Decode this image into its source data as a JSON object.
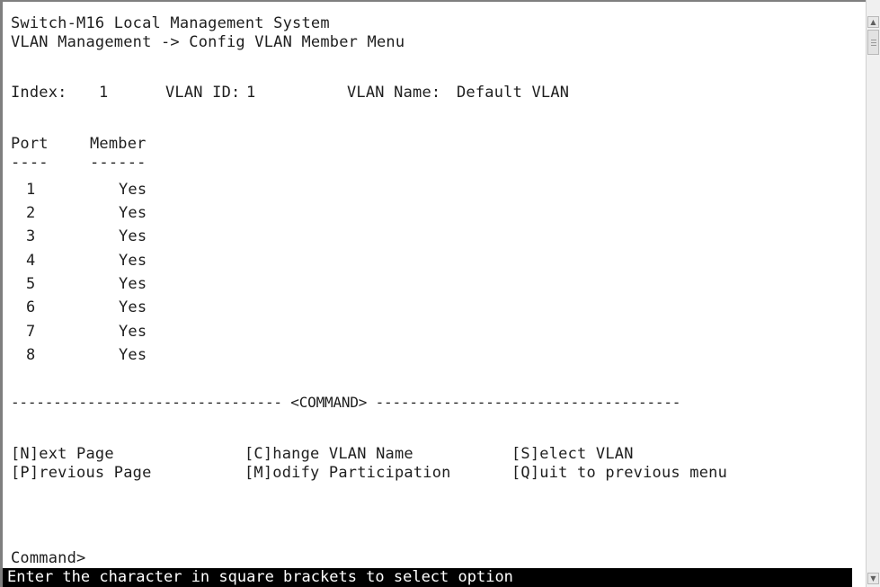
{
  "header": {
    "system_title": "Switch-M16 Local Management System",
    "breadcrumb": "VLAN Management -> Config VLAN Member Menu"
  },
  "vlan_info": {
    "index_label": "Index:",
    "index_value": "1",
    "vlan_id_label": "VLAN ID:",
    "vlan_id_value": "1",
    "vlan_name_label": "VLAN Name:",
    "vlan_name_value": "Default VLAN"
  },
  "table": {
    "col_port": "Port",
    "col_member": "Member",
    "sep_port": "----",
    "sep_member": "------",
    "rows": [
      {
        "port": "1",
        "member": "Yes"
      },
      {
        "port": "2",
        "member": "Yes"
      },
      {
        "port": "3",
        "member": "Yes"
      },
      {
        "port": "4",
        "member": "Yes"
      },
      {
        "port": "5",
        "member": "Yes"
      },
      {
        "port": "6",
        "member": "Yes"
      },
      {
        "port": "7",
        "member": "Yes"
      },
      {
        "port": "8",
        "member": "Yes"
      }
    ]
  },
  "command_divider": "-------------------------------- <COMMAND> ------------------------------------",
  "commands": {
    "next_page": "[N]ext Page",
    "previous_page": "[P]revious Page",
    "change_vlan_name": "[C]hange VLAN Name",
    "modify_participation": "[M]odify Participation",
    "select_vlan": "[S]elect VLAN",
    "quit": "[Q]uit to previous menu"
  },
  "prompt": "Command>",
  "status_bar": "Enter the character in square brackets to select option",
  "icons": {
    "scroll_up": "scroll-up-arrow-icon",
    "scroll_down": "scroll-down-arrow-icon"
  },
  "colors": {
    "background": "#ffffff",
    "text": "#1e1e1e",
    "status_bg": "#000000",
    "status_text": "#ffffff"
  }
}
